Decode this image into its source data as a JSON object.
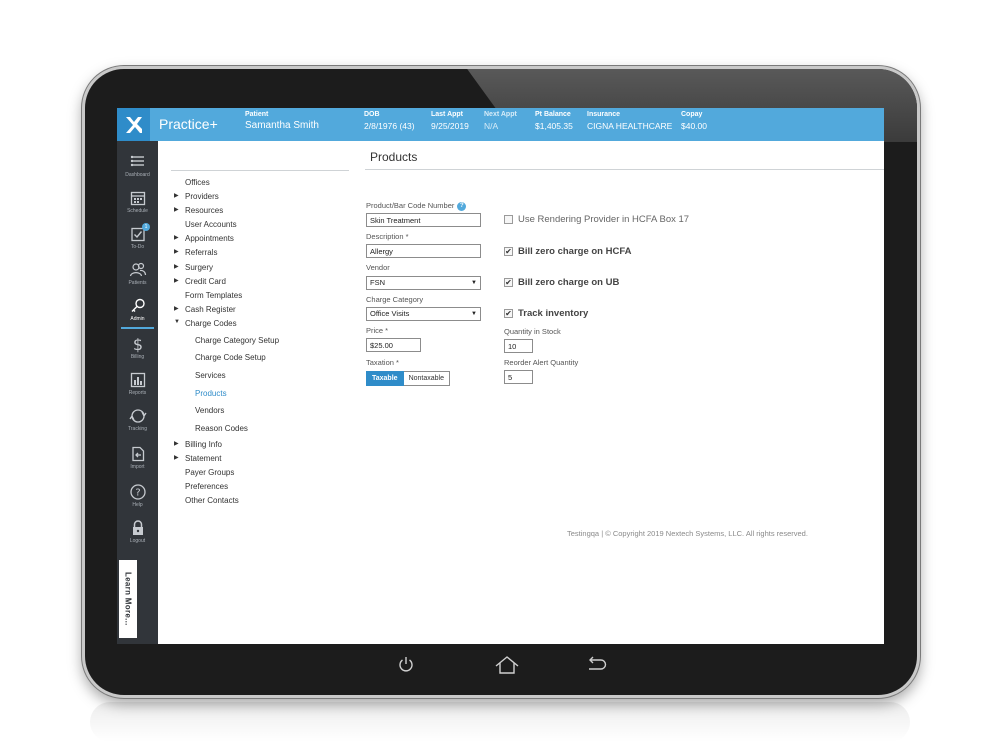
{
  "app": {
    "title": "Practice+"
  },
  "header": {
    "patient": {
      "label": "Patient",
      "value": "Samantha Smith"
    },
    "dob": {
      "label": "DOB",
      "value": "2/8/1976 (43)"
    },
    "last_appt": {
      "label": "Last Appt",
      "value": "9/25/2019"
    },
    "next_appt": {
      "label": "Next Appt",
      "value": "N/A"
    },
    "pt_balance": {
      "label": "Pt Balance",
      "value": "$1,405.35"
    },
    "insurance": {
      "label": "Insurance",
      "value": "CIGNA HEALTHCARE"
    },
    "copay": {
      "label": "Copay",
      "value": "$40.00"
    }
  },
  "sidebar": {
    "items": [
      {
        "label": "Dashboard",
        "icon": "dashboard-icon"
      },
      {
        "label": "Schedule",
        "icon": "calendar-icon"
      },
      {
        "label": "To-Do",
        "icon": "todo-icon",
        "badge": "1"
      },
      {
        "label": "Patients",
        "icon": "patients-icon"
      },
      {
        "label": "Admin",
        "icon": "key-icon"
      },
      {
        "label": "Billing",
        "icon": "dollar-icon"
      },
      {
        "label": "Reports",
        "icon": "reports-icon"
      },
      {
        "label": "Tracking",
        "icon": "tracking-icon"
      },
      {
        "label": "Import",
        "icon": "import-icon"
      },
      {
        "label": "Help",
        "icon": "help-icon"
      },
      {
        "label": "Logout",
        "icon": "lock-icon"
      }
    ],
    "active": "Admin",
    "learn_more": "Learn More..."
  },
  "tree": {
    "items": [
      {
        "label": "Offices"
      },
      {
        "label": "Providers"
      },
      {
        "label": "Resources"
      },
      {
        "label": "User Accounts"
      },
      {
        "label": "Appointments"
      },
      {
        "label": "Referrals"
      },
      {
        "label": "Surgery"
      },
      {
        "label": "Credit Card"
      },
      {
        "label": "Form Templates"
      },
      {
        "label": "Cash Register"
      },
      {
        "label": "Charge Codes"
      },
      {
        "label": "Charge Category Setup"
      },
      {
        "label": "Charge Code Setup"
      },
      {
        "label": "Services"
      },
      {
        "label": "Products"
      },
      {
        "label": "Vendors"
      },
      {
        "label": "Reason Codes"
      },
      {
        "label": "Billing Info"
      },
      {
        "label": "Statement"
      },
      {
        "label": "Payer Groups"
      },
      {
        "label": "Preferences"
      },
      {
        "label": "Other Contacts"
      }
    ],
    "selected": "Products"
  },
  "main": {
    "title": "Products",
    "fields": {
      "product_code": {
        "label": "Product/Bar Code Number",
        "value": "Skin Treatment"
      },
      "description": {
        "label": "Description *",
        "value": "Allergy"
      },
      "vendor": {
        "label": "Vendor",
        "value": "FSN"
      },
      "charge_category": {
        "label": "Charge Category",
        "value": "Office Visits"
      },
      "price": {
        "label": "Price *",
        "value": "$25.00"
      },
      "taxation": {
        "label": "Taxation *",
        "options": [
          "Taxable",
          "Nontaxable"
        ],
        "selected": "Taxable"
      },
      "quantity_in_stock": {
        "label": "Quantity in Stock",
        "value": "10"
      },
      "reorder_alert": {
        "label": "Reorder Alert Quantity",
        "value": "5"
      }
    },
    "checkboxes": {
      "rendering_provider": {
        "label": "Use Rendering Provider in HCFA Box 17",
        "checked": false
      },
      "bill_zero_hcfa": {
        "label": "Bill zero charge on HCFA",
        "checked": true
      },
      "bill_zero_ub": {
        "label": "Bill zero charge on UB",
        "checked": true
      },
      "track_inventory": {
        "label": "Track inventory",
        "checked": true
      }
    },
    "footer": "Testingqa | © Copyright 2019 Nextech Systems, LLC. All rights reserved."
  },
  "colors": {
    "topbar": "#52a9dc",
    "sidebar": "#31353a",
    "accent": "#2f8cc9",
    "bezel": "#1c1c1c"
  }
}
